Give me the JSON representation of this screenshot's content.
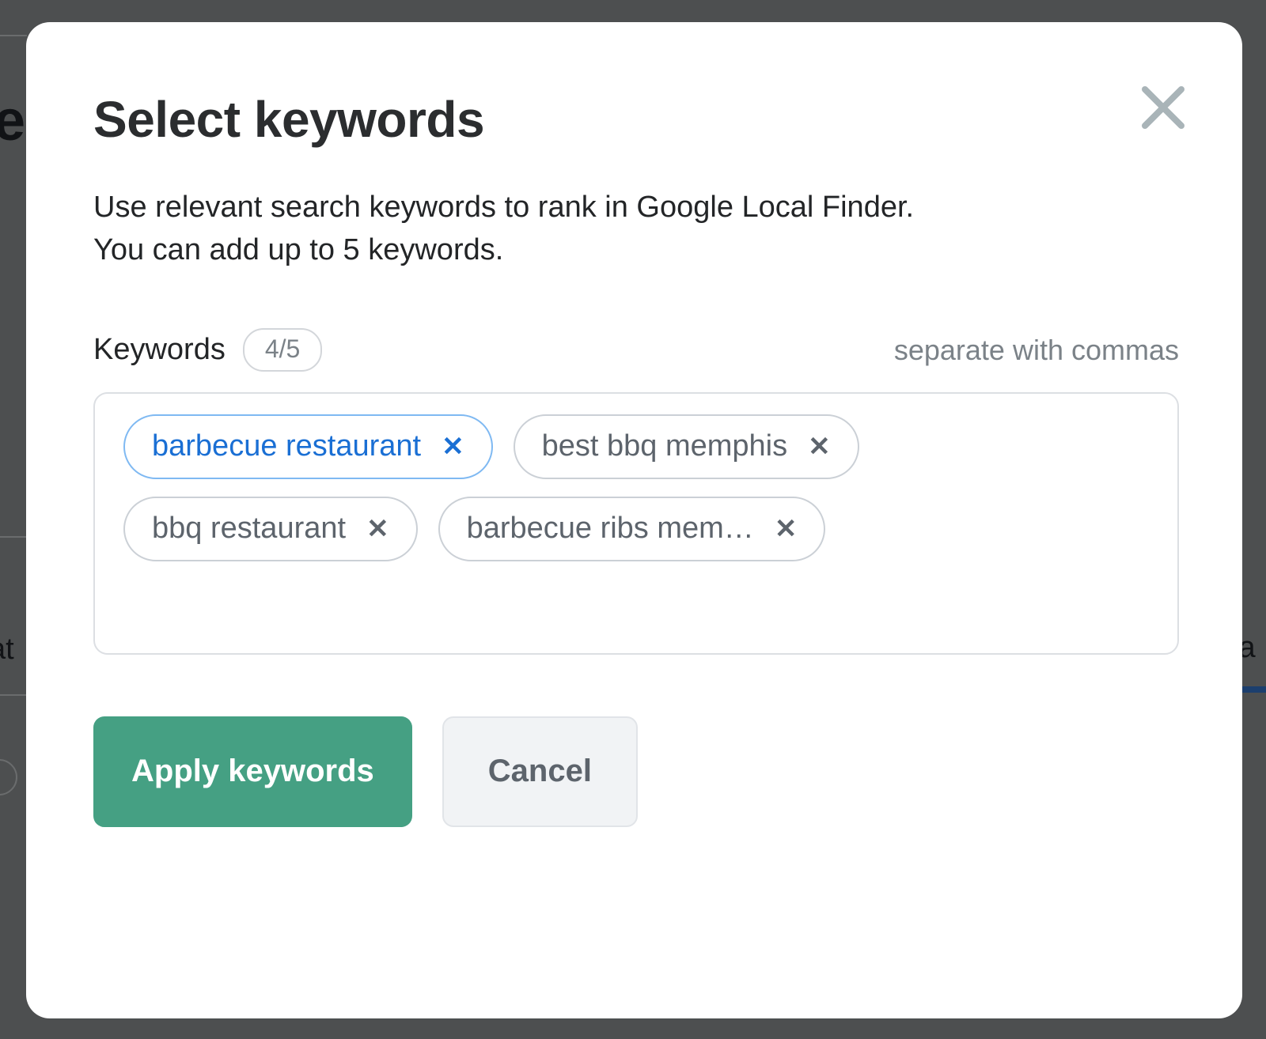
{
  "background": {
    "fragment_left_top": "e",
    "fragment_left_mid": "at",
    "fragment_right_mid": "Ra"
  },
  "modal": {
    "title": "Select keywords",
    "description_line1": "Use relevant search keywords to rank in Google Local Finder.",
    "description_line2": "You can add up to 5 keywords.",
    "close_icon": "close-icon",
    "field": {
      "label": "Keywords",
      "count": "4/5",
      "hint": "separate with commas",
      "tags": [
        {
          "label": "barbecue restaurant",
          "remove_icon": "✕",
          "selected": true
        },
        {
          "label": "best bbq memphis",
          "remove_icon": "✕",
          "selected": false
        },
        {
          "label": "bbq restaurant",
          "remove_icon": "✕",
          "selected": false
        },
        {
          "label": "barbecue ribs mem…",
          "remove_icon": "✕",
          "selected": false
        }
      ]
    },
    "actions": {
      "apply_label": "Apply keywords",
      "cancel_label": "Cancel"
    }
  },
  "colors": {
    "overlay": "#4d4f50",
    "primary_green": "#45a083",
    "selected_blue_text": "#1a6fd4",
    "selected_blue_border": "#7fb9f2",
    "tag_border": "#cbd0d6",
    "muted_text": "#7b8288"
  }
}
